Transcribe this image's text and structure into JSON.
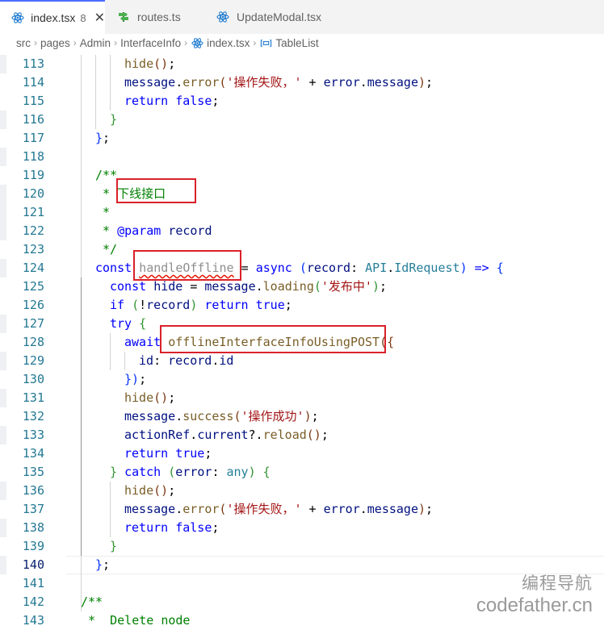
{
  "tabs": [
    {
      "label": "index.tsx",
      "badge": "8",
      "active": true,
      "icon": "react-icon"
    },
    {
      "label": "routes.ts",
      "active": false,
      "icon": "route-signpost-icon"
    },
    {
      "label": "UpdateModal.tsx",
      "active": false,
      "icon": "react-icon"
    }
  ],
  "tab_close": "✕",
  "breadcrumb": [
    "src",
    "pages",
    "Admin",
    "InterfaceInfo",
    "index.tsx",
    "TableList"
  ],
  "colors": {
    "keyword": "#0000ff",
    "string": "#a31515",
    "comment": "#008000",
    "function": "#795e26",
    "highlight_box": "#d9212a",
    "line_number": "#237893"
  },
  "current_line": "140",
  "lines": [
    {
      "no": "113",
      "indent": 2,
      "tokens": [
        [
          "f",
          "hide"
        ],
        [
          "b3",
          "()"
        ],
        [
          "n",
          ";"
        ]
      ]
    },
    {
      "no": "114",
      "indent": 2,
      "tokens": [
        [
          "v",
          "message"
        ],
        [
          "n",
          "."
        ],
        [
          "f",
          "error"
        ],
        [
          "b3",
          "("
        ],
        [
          "s",
          "'操作失败，'"
        ],
        [
          "n",
          " + "
        ],
        [
          "v",
          "error"
        ],
        [
          "n",
          "."
        ],
        [
          "v",
          "message"
        ],
        [
          "b3",
          ")"
        ],
        [
          "n",
          ";"
        ]
      ]
    },
    {
      "no": "115",
      "indent": 2,
      "tokens": [
        [
          "k",
          "return"
        ],
        [
          "n",
          " "
        ],
        [
          "k",
          "false"
        ],
        [
          "n",
          ";"
        ]
      ]
    },
    {
      "no": "116",
      "indent": 1.5,
      "tokens": [
        [
          "b2",
          "}"
        ]
      ]
    },
    {
      "no": "117",
      "indent": 1,
      "tokens": [
        [
          "b1",
          "}"
        ],
        [
          "n",
          ";"
        ]
      ]
    },
    {
      "no": "118",
      "indent": 0,
      "tokens": []
    },
    {
      "no": "119",
      "indent": 1,
      "tokens": [
        [
          "c",
          "/**"
        ]
      ]
    },
    {
      "no": "120",
      "indent": 1,
      "tokens": [
        [
          "c",
          " * 下线接口"
        ]
      ]
    },
    {
      "no": "121",
      "indent": 1,
      "tokens": [
        [
          "c",
          " *"
        ]
      ]
    },
    {
      "no": "122",
      "indent": 1,
      "tokens": [
        [
          "c",
          " * "
        ],
        [
          "k",
          "@param"
        ],
        [
          "c",
          " "
        ],
        [
          "v",
          "record"
        ]
      ]
    },
    {
      "no": "123",
      "indent": 1,
      "tokens": [
        [
          "c",
          " */"
        ]
      ]
    },
    {
      "no": "124",
      "indent": 1,
      "tokens": [
        [
          "k",
          "const"
        ],
        [
          "n",
          " "
        ],
        [
          "dim",
          "handleOffline"
        ],
        [
          "n",
          " = "
        ],
        [
          "k",
          "async"
        ],
        [
          "n",
          " "
        ],
        [
          "b1",
          "("
        ],
        [
          "v",
          "record"
        ],
        [
          "n",
          ": "
        ],
        [
          "t",
          "API"
        ],
        [
          "n",
          "."
        ],
        [
          "t",
          "IdRequest"
        ],
        [
          "b1",
          ")"
        ],
        [
          "n",
          " "
        ],
        [
          "k",
          "=>"
        ],
        [
          "n",
          " "
        ],
        [
          "b1",
          "{"
        ]
      ]
    },
    {
      "no": "125",
      "indent": 1.5,
      "tokens": [
        [
          "k",
          "const"
        ],
        [
          "n",
          " "
        ],
        [
          "v",
          "hide"
        ],
        [
          "n",
          " = "
        ],
        [
          "v",
          "message"
        ],
        [
          "n",
          "."
        ],
        [
          "f",
          "loading"
        ],
        [
          "b2",
          "("
        ],
        [
          "s",
          "'发布中'"
        ],
        [
          "b2",
          ")"
        ],
        [
          "n",
          ";"
        ]
      ]
    },
    {
      "no": "126",
      "indent": 1.5,
      "tokens": [
        [
          "k",
          "if"
        ],
        [
          "n",
          " "
        ],
        [
          "b2",
          "("
        ],
        [
          "n",
          "!"
        ],
        [
          "v",
          "record"
        ],
        [
          "b2",
          ")"
        ],
        [
          "n",
          " "
        ],
        [
          "k",
          "return"
        ],
        [
          "n",
          " "
        ],
        [
          "k",
          "true"
        ],
        [
          "n",
          ";"
        ]
      ]
    },
    {
      "no": "127",
      "indent": 1.5,
      "tokens": [
        [
          "k",
          "try"
        ],
        [
          "n",
          " "
        ],
        [
          "b2",
          "{"
        ]
      ]
    },
    {
      "no": "128",
      "indent": 2,
      "tokens": [
        [
          "k",
          "await"
        ],
        [
          "n",
          " "
        ],
        [
          "f",
          "offlineInterfaceInfoUsingPOST"
        ],
        [
          "b3",
          "({"
        ]
      ]
    },
    {
      "no": "129",
      "indent": 2.5,
      "tokens": [
        [
          "v",
          "id"
        ],
        [
          "n",
          ": "
        ],
        [
          "v",
          "record"
        ],
        [
          "n",
          "."
        ],
        [
          "v",
          "id"
        ]
      ]
    },
    {
      "no": "130",
      "indent": 2,
      "tokens": [
        [
          "b1",
          "})"
        ],
        [
          "n",
          ";"
        ]
      ]
    },
    {
      "no": "131",
      "indent": 2,
      "tokens": [
        [
          "f",
          "hide"
        ],
        [
          "b3",
          "()"
        ],
        [
          "n",
          ";"
        ]
      ]
    },
    {
      "no": "132",
      "indent": 2,
      "tokens": [
        [
          "v",
          "message"
        ],
        [
          "n",
          "."
        ],
        [
          "f",
          "success"
        ],
        [
          "b3",
          "("
        ],
        [
          "s",
          "'操作成功'"
        ],
        [
          "b3",
          ")"
        ],
        [
          "n",
          ";"
        ]
      ]
    },
    {
      "no": "133",
      "indent": 2,
      "tokens": [
        [
          "v",
          "actionRef"
        ],
        [
          "n",
          "."
        ],
        [
          "v",
          "current"
        ],
        [
          "n",
          "?."
        ],
        [
          "f",
          "reload"
        ],
        [
          "b3",
          "()"
        ],
        [
          "n",
          ";"
        ]
      ]
    },
    {
      "no": "134",
      "indent": 2,
      "tokens": [
        [
          "k",
          "return"
        ],
        [
          "n",
          " "
        ],
        [
          "k",
          "true"
        ],
        [
          "n",
          ";"
        ]
      ]
    },
    {
      "no": "135",
      "indent": 1.5,
      "tokens": [
        [
          "b2",
          "}"
        ],
        [
          "n",
          " "
        ],
        [
          "k",
          "catch"
        ],
        [
          "n",
          " "
        ],
        [
          "b2",
          "("
        ],
        [
          "v",
          "error"
        ],
        [
          "n",
          ": "
        ],
        [
          "t",
          "any"
        ],
        [
          "b2",
          ")"
        ],
        [
          "n",
          " "
        ],
        [
          "b2",
          "{"
        ]
      ]
    },
    {
      "no": "136",
      "indent": 2,
      "tokens": [
        [
          "f",
          "hide"
        ],
        [
          "b3",
          "()"
        ],
        [
          "n",
          ";"
        ]
      ]
    },
    {
      "no": "137",
      "indent": 2,
      "tokens": [
        [
          "v",
          "message"
        ],
        [
          "n",
          "."
        ],
        [
          "f",
          "error"
        ],
        [
          "b3",
          "("
        ],
        [
          "s",
          "'操作失败，'"
        ],
        [
          "n",
          " + "
        ],
        [
          "v",
          "error"
        ],
        [
          "n",
          "."
        ],
        [
          "v",
          "message"
        ],
        [
          "b3",
          ")"
        ],
        [
          "n",
          ";"
        ]
      ]
    },
    {
      "no": "138",
      "indent": 2,
      "tokens": [
        [
          "k",
          "return"
        ],
        [
          "n",
          " "
        ],
        [
          "k",
          "false"
        ],
        [
          "n",
          ";"
        ]
      ]
    },
    {
      "no": "139",
      "indent": 1.5,
      "tokens": [
        [
          "b2",
          "}"
        ]
      ]
    },
    {
      "no": "140",
      "indent": 1,
      "tokens": [
        [
          "b1",
          "}"
        ],
        [
          "n",
          ";"
        ]
      ]
    },
    {
      "no": "141",
      "indent": 0,
      "tokens": []
    },
    {
      "no": "142",
      "indent": 0.5,
      "tokens": [
        [
          "c",
          "/**"
        ]
      ]
    },
    {
      "no": "143",
      "indent": 0.5,
      "tokens": [
        [
          "c",
          " *  Delete node"
        ]
      ]
    }
  ],
  "watermark": {
    "line1": "编程导航",
    "line2": "codefather.cn"
  }
}
